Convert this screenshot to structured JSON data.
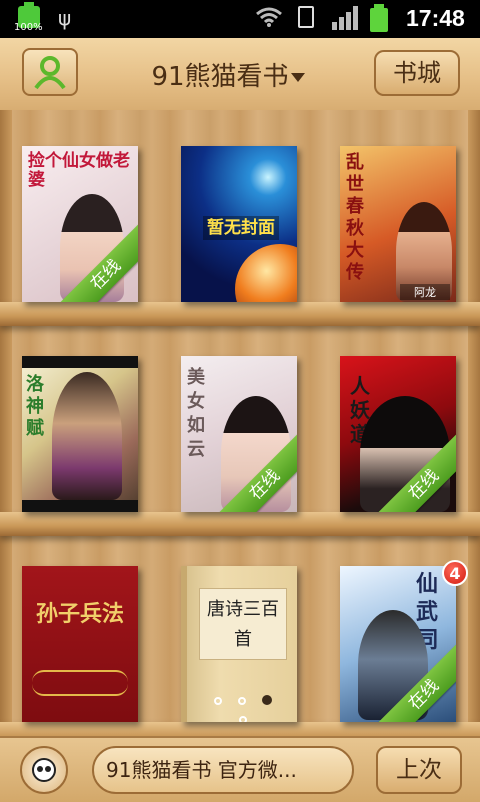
{
  "status_bar": {
    "battery_left_percent": "100%",
    "time": "17:48",
    "icons": [
      "battery-icon",
      "usb-icon",
      "wifi-icon",
      "sd-card-icon",
      "signal-icon",
      "battery-charging-icon"
    ]
  },
  "header": {
    "title": "91熊猫看书",
    "store_label": "书城",
    "profile_icon": "user-icon"
  },
  "shelf": {
    "books": [
      {
        "cover_text": "捡个仙女做老婆",
        "online": true,
        "online_label": "在线"
      },
      {
        "cover_text": "暂无封面",
        "online": false
      },
      {
        "cover_text": "乱世春秋大传",
        "online": false,
        "extra": "阿龙"
      },
      {
        "cover_text": "洛神赋",
        "online": false
      },
      {
        "cover_text": "美女如云",
        "online": true,
        "online_label": "在线"
      },
      {
        "cover_text": "人妖道",
        "online": true,
        "online_label": "在线"
      },
      {
        "cover_text": "孙子兵法",
        "online": false
      },
      {
        "cover_text": "唐诗三百首",
        "online": false,
        "pager_total": 4,
        "pager_active_index": 2
      },
      {
        "cover_text": "仙武同",
        "online": true,
        "online_label": "在线",
        "badge_count": "4"
      }
    ]
  },
  "bottom": {
    "news_text": "91熊猫看书 官方微...",
    "last_label": "上次",
    "panda_icon": "panda-icon"
  },
  "colors": {
    "wood_light": "#e6c088",
    "wood_dark": "#a97b44",
    "online_green": "#5aa828",
    "badge_red": "#d11a10"
  }
}
